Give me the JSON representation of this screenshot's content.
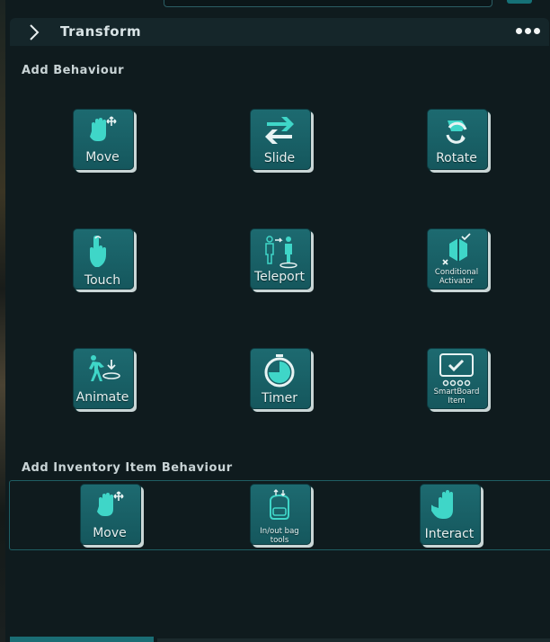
{
  "header": {
    "title": "Transform",
    "more_icon": "ellipsis-icon",
    "expand_icon": "chevron-right-icon"
  },
  "sections": {
    "behaviour_title": "Add Behaviour",
    "inventory_title": "Add Inventory Item Behaviour"
  },
  "behaviours": [
    {
      "label": "Move",
      "icon": "hand-move-icon"
    },
    {
      "label": "Slide",
      "icon": "slide-arrows-icon"
    },
    {
      "label": "Rotate",
      "icon": "rotate-icon"
    },
    {
      "label": "Touch",
      "icon": "finger-touch-icon"
    },
    {
      "label": "Teleport",
      "icon": "teleport-icon"
    },
    {
      "label": "Conditional Activator",
      "icon": "conditional-activator-icon"
    },
    {
      "label": "Animate",
      "icon": "animate-icon"
    },
    {
      "label": "Timer",
      "icon": "stopwatch-icon"
    },
    {
      "label": "SmartBoard Item",
      "icon": "smartboard-icon"
    }
  ],
  "inventory_behaviours": [
    {
      "label": "Move",
      "icon": "hand-move-icon"
    },
    {
      "label": "In/out bag tools",
      "icon": "backpack-icon"
    },
    {
      "label": "Interact",
      "icon": "hand-interact-icon"
    }
  ],
  "colors": {
    "tile": "#1d6a70",
    "icon": "#3fd6c8",
    "background": "#0f1b1e"
  }
}
